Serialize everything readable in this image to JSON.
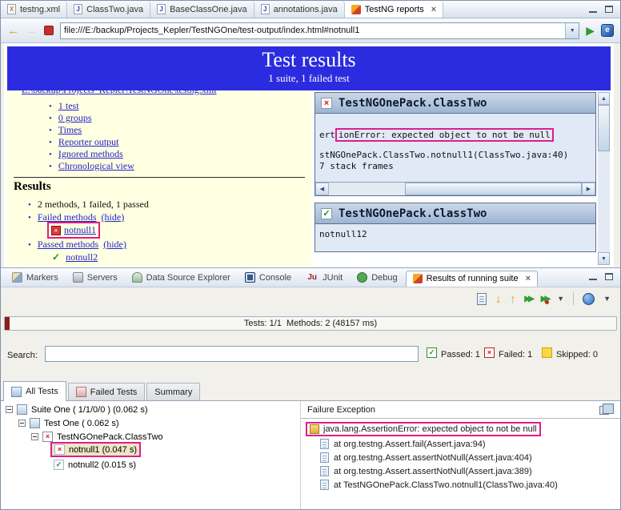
{
  "colors": {
    "banner_blue": "#2b2ce0",
    "annotation_magenta": "#e01c8c",
    "link_blue": "#2323cc",
    "pass_green": "#1f8f1f",
    "fail_red": "#cc1a1a"
  },
  "editor_tabs": [
    {
      "label": "testng.xml"
    },
    {
      "label": "ClassTwo.java"
    },
    {
      "label": "BaseClassOne.java"
    },
    {
      "label": "annotations.java"
    },
    {
      "label": "TestNG reports"
    }
  ],
  "browser": {
    "url": "file:///E:/backup/Projects_Kepler/TestNGOne/test-output/index.html#notnull1"
  },
  "banner": {
    "title": "Test results",
    "subtitle": "1 suite, 1 failed test"
  },
  "report_nav": {
    "clipped_link": "E:\\backup\\Projects_Kepler\\TestNGOne\\testng.xml",
    "links": [
      {
        "label": "1 test"
      },
      {
        "label": "0 groups"
      },
      {
        "label": "Times"
      },
      {
        "label": "Reporter output"
      },
      {
        "label": "Ignored methods"
      },
      {
        "label": "Chronological view"
      }
    ],
    "results_heading": "Results",
    "summary": "2 methods, 1 failed, 1 passed",
    "failed_group_label": "Failed methods",
    "failed_group_action": "(hide)",
    "failed_method": "notnull1",
    "passed_group_label": "Passed methods",
    "passed_group_action": "(hide)",
    "passed_method": "notnull2"
  },
  "report_detail": {
    "failed_panel": {
      "title": "TestNGOnePack.ClassTwo",
      "line1_prefix": "ert",
      "line1_highlighted": "ionError: expected object to not be null",
      "line2": "stNGOnePack.ClassTwo.notnull1(ClassTwo.java:40)",
      "line3": "7 stack frames"
    },
    "passed_panel": {
      "title": "TestNGOnePack.ClassTwo",
      "content": "notnull12"
    }
  },
  "view_tabs": [
    {
      "label": "Markers"
    },
    {
      "label": "Servers"
    },
    {
      "label": "Data Source Explorer"
    },
    {
      "label": "Console"
    },
    {
      "label": "JUnit"
    },
    {
      "label": "Debug"
    },
    {
      "label": "Results of running suite"
    }
  ],
  "testng_view": {
    "counter_text": "Tests: 1/1  Methods: 2 (48157 ms)",
    "search_label": "Search:",
    "passed_label": "Passed: 1",
    "failed_label": "Failed: 1",
    "skipped_label": "Skipped: 0",
    "result_tabs": [
      {
        "label": "All Tests"
      },
      {
        "label": "Failed Tests"
      },
      {
        "label": "Summary"
      }
    ],
    "tree": [
      {
        "label": "Suite One ( 1/1/0/0 ) (0.062 s)"
      },
      {
        "label": "Test One ( 0.062 s)"
      },
      {
        "label": "TestNGOnePack.ClassTwo"
      },
      {
        "label": "notnull1 (0.047 s)"
      },
      {
        "label": "notnull2 (0.015 s)"
      }
    ],
    "failure_panel": {
      "header": "Failure Exception",
      "exception_line": "java.lang.AssertionError: expected object to not be null",
      "stack_lines": [
        {
          "text": "at org.testng.Assert.fail(Assert.java:94)"
        },
        {
          "text": "at org.testng.Assert.assertNotNull(Assert.java:404)"
        },
        {
          "text": "at org.testng.Assert.assertNotNull(Assert.java:389)"
        },
        {
          "text": "at TestNGOnePack.ClassTwo.notnull1(ClassTwo.java:40)"
        }
      ]
    }
  }
}
